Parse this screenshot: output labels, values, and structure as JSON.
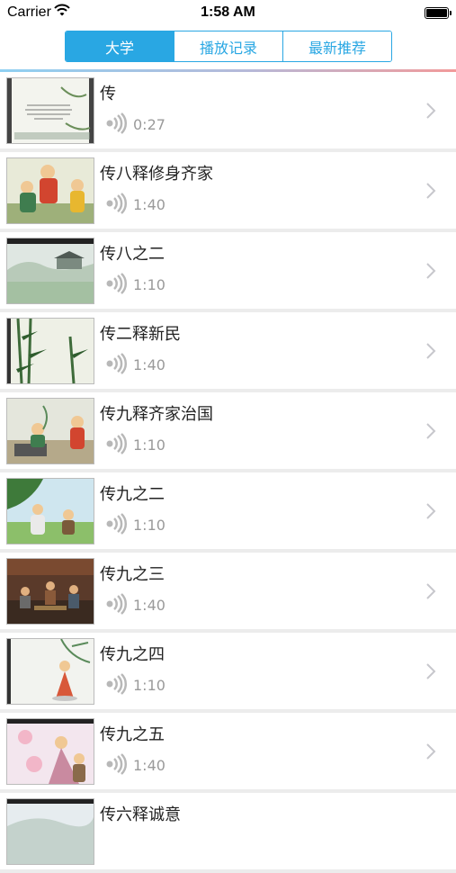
{
  "status_bar": {
    "carrier": "Carrier",
    "time": "1:58 AM"
  },
  "tabs": [
    {
      "label": "大学",
      "active": true
    },
    {
      "label": "播放记录",
      "active": false
    },
    {
      "label": "最新推荐",
      "active": false
    }
  ],
  "colors": {
    "accent": "#29a7e3",
    "duration": "#9a9a9a",
    "separator": "#ececec"
  },
  "items": [
    {
      "title": "传",
      "duration": "0:27"
    },
    {
      "title": "传八释修身齐家",
      "duration": "1:40"
    },
    {
      "title": "传八之二",
      "duration": "1:10"
    },
    {
      "title": "传二释新民",
      "duration": "1:40"
    },
    {
      "title": "传九释齐家治国",
      "duration": "1:10"
    },
    {
      "title": "传九之二",
      "duration": "1:10"
    },
    {
      "title": "传九之三",
      "duration": "1:40"
    },
    {
      "title": "传九之四",
      "duration": "1:10"
    },
    {
      "title": "传九之五",
      "duration": "1:40"
    },
    {
      "title": "传六释诚意",
      "duration": ""
    }
  ],
  "icons": {
    "wifi": "wifi-icon",
    "battery": "battery-icon",
    "audio": "speaker-wave-icon",
    "chevron": "chevron-right-icon"
  }
}
